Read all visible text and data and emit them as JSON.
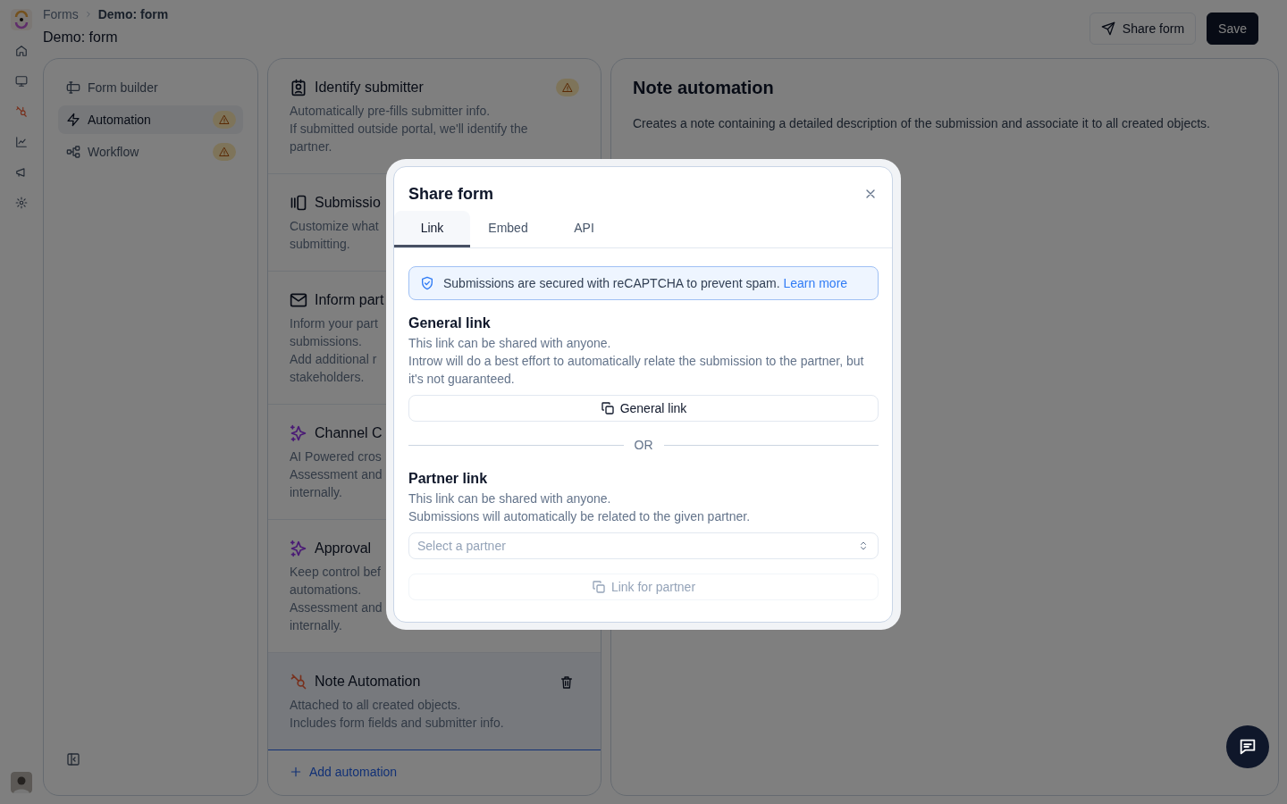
{
  "breadcrumb": [
    {
      "label": "Forms",
      "current": false
    },
    {
      "label": "Demo: form",
      "current": true
    }
  ],
  "page_title": "Demo: form",
  "header_buttons": [
    {
      "label": "Share form",
      "kind": "secondary"
    },
    {
      "label": "Save",
      "kind": "primary"
    }
  ],
  "nav": [
    {
      "label": "Form builder",
      "selected": false,
      "warning": false
    },
    {
      "label": "Automation",
      "selected": true,
      "warning": true
    },
    {
      "label": "Workflow",
      "selected": false,
      "warning": true
    }
  ],
  "automations": [
    {
      "title": "Identify submitter",
      "lines": [
        "Automatically pre-fills submitter info.",
        "If submitted outside portal, we'll identify the partner."
      ],
      "warning": true,
      "selected": false
    },
    {
      "title": "Submissio",
      "lines": [
        "Customize what",
        "submitting."
      ],
      "warning": false,
      "selected": false
    },
    {
      "title": "Inform part",
      "lines": [
        "Inform your part",
        "submissions.",
        "Add additional r",
        "stakeholders."
      ],
      "warning": false,
      "selected": false
    },
    {
      "title": "Channel C",
      "lines": [
        "AI Powered cros",
        "Assessment and",
        "internally."
      ],
      "warning": false,
      "selected": false
    },
    {
      "title": "Approval",
      "lines": [
        "Keep control bef",
        "automations.",
        "Assessment and",
        "internally."
      ],
      "warning": false,
      "selected": false
    },
    {
      "title": "Note Automation",
      "lines": [
        "Attached to all created objects.",
        "Includes form fields and submitter info."
      ],
      "warning": false,
      "selected": true
    }
  ],
  "add_automation": "Add automation",
  "detail": {
    "title": "Note automation",
    "description": "Creates a note containing a detailed description of the submission and associate it to all created objects."
  },
  "dialog": {
    "title": "Share form",
    "tabs": [
      {
        "label": "Link",
        "selected": true
      },
      {
        "label": "Embed",
        "selected": false
      },
      {
        "label": "API",
        "selected": false
      }
    ],
    "notice": {
      "text": "Submissions are secured with reCAPTCHA to prevent spam.",
      "link": "Learn more"
    },
    "general": {
      "heading": "General link",
      "lines": [
        "This link can be shared with anyone.",
        "Introw will do a best effort to automatically relate the submission to the partner, but it's not guaranteed."
      ],
      "button": {
        "label": "General link",
        "disabled": false
      }
    },
    "separator": "OR",
    "partner": {
      "heading": "Partner link",
      "lines": [
        "This link can be shared with anyone.",
        "Submissions will automatically be related to the given partner."
      ],
      "select": {
        "placeholder": "Select a partner"
      },
      "button": {
        "label": "Link for partner",
        "disabled": true
      }
    }
  }
}
